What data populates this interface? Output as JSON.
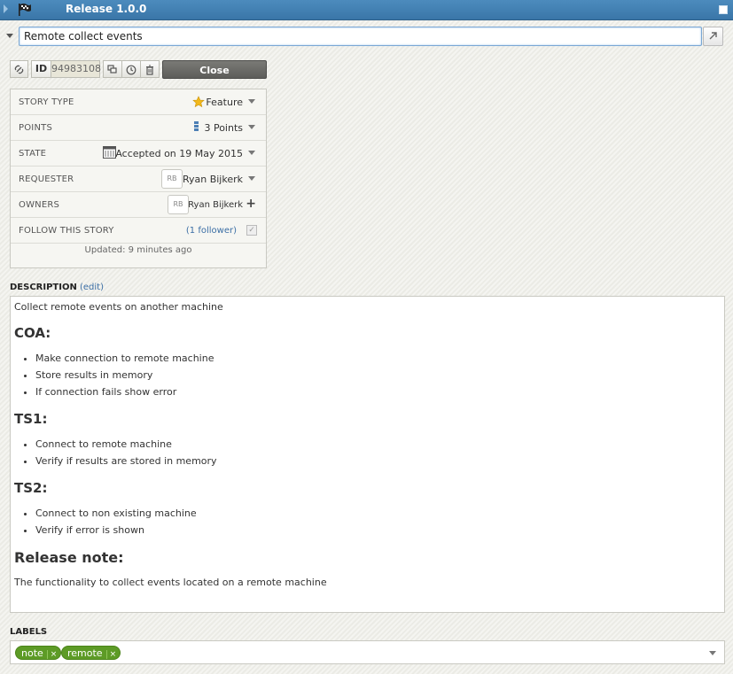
{
  "header": {
    "title": "Release 1.0.0"
  },
  "story": {
    "name": "Remote collect events",
    "id_label": "ID",
    "id_value": "94983108",
    "close_label": "Close"
  },
  "details": {
    "story_type": {
      "label": "STORY TYPE",
      "value": "Feature"
    },
    "points": {
      "label": "POINTS",
      "value": "3 Points"
    },
    "state": {
      "label": "STATE",
      "value": "Accepted on 19 May 2015"
    },
    "requester": {
      "label": "REQUESTER",
      "initials": "RB",
      "value": "Ryan Bijkerk"
    },
    "owners": {
      "label": "OWNERS",
      "initials": "RB",
      "value": "Ryan Bijkerk"
    },
    "follow": {
      "label": "FOLLOW THIS STORY",
      "link": "(1 follower)"
    },
    "updated": "Updated: 9 minutes ago"
  },
  "description": {
    "label": "DESCRIPTION",
    "edit_label": "(edit)",
    "intro": "Collect remote events on another machine",
    "sections": [
      {
        "heading": "COA:",
        "items": [
          "Make connection to remote machine",
          "Store results in memory",
          "If connection fails show error"
        ]
      },
      {
        "heading": "TS1:",
        "items": [
          "Connect to remote machine",
          "Verify if results are stored in memory"
        ]
      },
      {
        "heading": "TS2:",
        "items": [
          "Connect to non existing machine",
          "Verify if error is shown"
        ]
      }
    ],
    "release_heading": "Release note:",
    "release_text": "The functionality to collect events located on a remote machine"
  },
  "labels": {
    "label": "LABELS",
    "tags": [
      "note",
      "remote"
    ],
    "remove_glyph": "×"
  }
}
